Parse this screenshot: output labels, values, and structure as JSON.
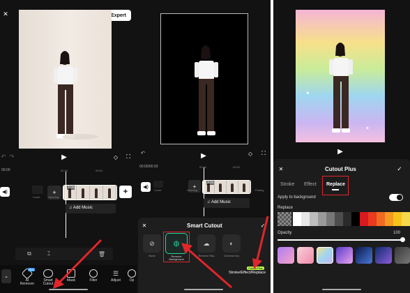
{
  "panel1": {
    "export_label": "Expert",
    "time_start": "00:00",
    "time_marks": [
      "00:00",
      "00:02"
    ],
    "clip_duration": "3.0s",
    "side_left_label": "Cover",
    "side_mid_label": "Opening",
    "side_right_label": "Ending",
    "add_music_label": "Add Music",
    "bottom_tools": [
      {
        "icon": "ai-remover-icon",
        "label": "AI Remover",
        "badge": "New"
      },
      {
        "icon": "smart-cutout-icon",
        "label": "Smart Cutout"
      },
      {
        "icon": "mask-icon",
        "label": "Mask"
      },
      {
        "icon": "filter-icon",
        "label": "Filter"
      },
      {
        "icon": "adjust-icon",
        "label": "Adjust"
      },
      {
        "icon": "more-icon",
        "label": "Op"
      }
    ]
  },
  "panel2": {
    "time_start": "00:00/00:03",
    "time_marks": [
      "00:00",
      "00:02"
    ],
    "clip_duration": "3.0s",
    "side_left_label": "Cover",
    "side_mid_label": "Opening",
    "side_right_label": "Ending",
    "add_music_label": "Add Music",
    "sheet_title": "Smart Cutout",
    "options": [
      {
        "icon": "none-icon",
        "label": "None"
      },
      {
        "icon": "remove-background-icon",
        "label": "Remove Background"
      },
      {
        "icon": "remove-sky-icon",
        "label": "Remove Sky"
      },
      {
        "icon": "chroma-key-icon",
        "label": "Chroma Key"
      }
    ],
    "cutout_plus_badge": "Cutout Plus",
    "cutout_plus_label": "Stroke/Effect/Replace"
  },
  "panel3": {
    "sheet_title": "Cutout Plus",
    "tabs": [
      "Stroke",
      "Effect",
      "Replace"
    ],
    "active_tab": "Replace",
    "apply_label": "Apply to background",
    "replace_label": "Replace",
    "opacity_label": "Opacity",
    "opacity_value": "100",
    "swatches": [
      "#ffffff",
      "#e6e6e6",
      "#bdbdbd",
      "#9a9a9a",
      "#777777",
      "#4d4d4d",
      "#2a2a2a",
      "#000000",
      "#d71920",
      "#ea3a1f",
      "#f06a22",
      "#f39a1f",
      "#f7c21a",
      "#f6d94a"
    ]
  },
  "colors": {
    "accent_green": "#2fd39a",
    "red_annotation": "#e0262b",
    "panel_bg": "#121212"
  }
}
